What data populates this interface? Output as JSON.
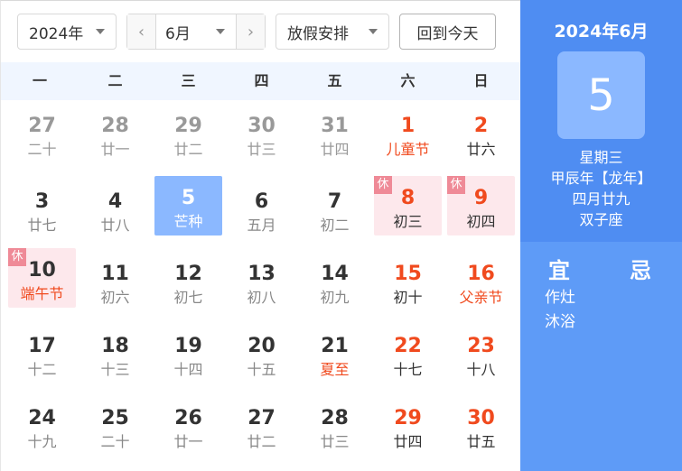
{
  "toolbar": {
    "year": "2024年",
    "month": "6月",
    "prev": "‹",
    "next": "›",
    "holiday": "放假安排",
    "today": "回到今天"
  },
  "weekdays": [
    "一",
    "二",
    "三",
    "四",
    "五",
    "六",
    "日"
  ],
  "rest_tag": "休",
  "days": [
    {
      "d": "27",
      "l": "二十",
      "t": "other"
    },
    {
      "d": "28",
      "l": "廿一",
      "t": "other"
    },
    {
      "d": "29",
      "l": "廿二",
      "t": "other"
    },
    {
      "d": "30",
      "l": "廿三",
      "t": "other"
    },
    {
      "d": "31",
      "l": "廿四",
      "t": "other"
    },
    {
      "d": "1",
      "l": "儿童节",
      "t": "weekend",
      "fest": true
    },
    {
      "d": "2",
      "l": "廿六",
      "t": "weekend"
    },
    {
      "d": "3",
      "l": "廿七",
      "t": "current"
    },
    {
      "d": "4",
      "l": "廿八",
      "t": "current"
    },
    {
      "d": "5",
      "l": "芒种",
      "t": "selected"
    },
    {
      "d": "6",
      "l": "五月",
      "t": "current"
    },
    {
      "d": "7",
      "l": "初二",
      "t": "current"
    },
    {
      "d": "8",
      "l": "初三",
      "t": "weekend",
      "rest": true
    },
    {
      "d": "9",
      "l": "初四",
      "t": "weekend",
      "rest": true
    },
    {
      "d": "10",
      "l": "端午节",
      "t": "weekend",
      "rest": true,
      "fest": true,
      "plainDay": true
    },
    {
      "d": "11",
      "l": "初六",
      "t": "current"
    },
    {
      "d": "12",
      "l": "初七",
      "t": "current"
    },
    {
      "d": "13",
      "l": "初八",
      "t": "current"
    },
    {
      "d": "14",
      "l": "初九",
      "t": "current"
    },
    {
      "d": "15",
      "l": "初十",
      "t": "weekend"
    },
    {
      "d": "16",
      "l": "父亲节",
      "t": "weekend",
      "fest": true
    },
    {
      "d": "17",
      "l": "十二",
      "t": "current"
    },
    {
      "d": "18",
      "l": "十三",
      "t": "current"
    },
    {
      "d": "19",
      "l": "十四",
      "t": "current"
    },
    {
      "d": "20",
      "l": "十五",
      "t": "current"
    },
    {
      "d": "21",
      "l": "夏至",
      "t": "current",
      "fest": true
    },
    {
      "d": "22",
      "l": "十七",
      "t": "weekend"
    },
    {
      "d": "23",
      "l": "十八",
      "t": "weekend"
    },
    {
      "d": "24",
      "l": "十九",
      "t": "current"
    },
    {
      "d": "25",
      "l": "二十",
      "t": "current"
    },
    {
      "d": "26",
      "l": "廿一",
      "t": "current"
    },
    {
      "d": "27",
      "l": "廿二",
      "t": "current"
    },
    {
      "d": "28",
      "l": "廿三",
      "t": "current"
    },
    {
      "d": "29",
      "l": "廿四",
      "t": "weekend"
    },
    {
      "d": "30",
      "l": "廿五",
      "t": "weekend"
    }
  ],
  "side": {
    "title": "2024年6月",
    "day": "5",
    "weekday": "星期三",
    "ganzhi": "甲辰年【龙年】",
    "lunar": "四月廿九",
    "zodiac": "双子座",
    "yi_label": "宜",
    "ji_label": "忌",
    "yi_items": [
      "作灶",
      "沐浴"
    ]
  },
  "colors": {
    "holiday_red": "#f04a1e",
    "selected_blue": "#8bb8ff",
    "side_blue": "#5e9bf7",
    "rest_pink": "#fde8ec"
  }
}
